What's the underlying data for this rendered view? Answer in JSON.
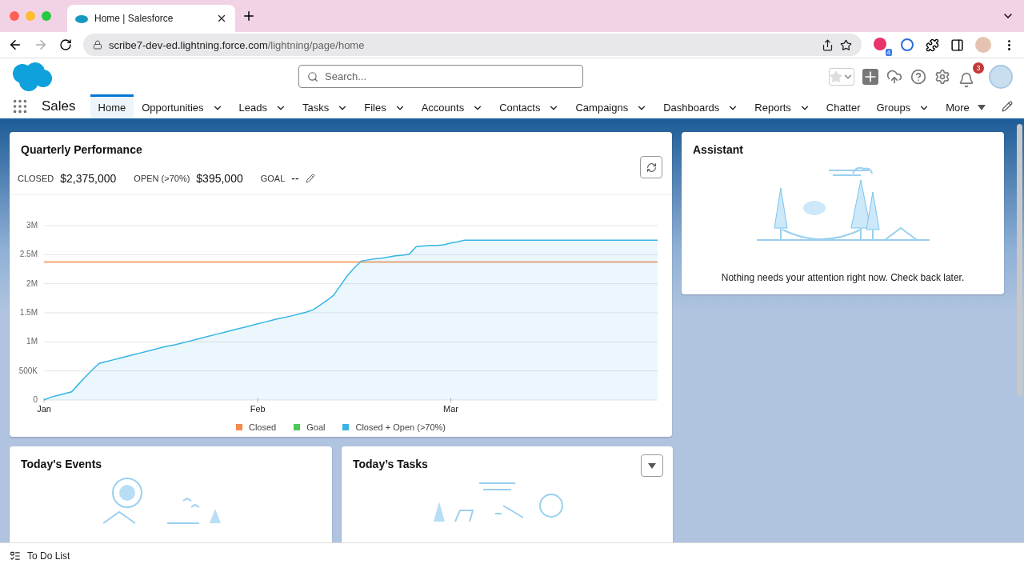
{
  "browser": {
    "tab_title": "Home | Salesforce",
    "url": {
      "host": "scribe7-dev-ed.lightning.force.com",
      "path": "/lightning/page/home"
    },
    "extension_badge": "4"
  },
  "header": {
    "search": {
      "placeholder": "Search..."
    },
    "notification_count": "3"
  },
  "nav": {
    "app_name": "Sales",
    "items": [
      {
        "label": "Home",
        "selected": true,
        "kind": "plain"
      },
      {
        "label": "Opportunities",
        "selected": false,
        "kind": "dropdown"
      },
      {
        "label": "Leads",
        "selected": false,
        "kind": "dropdown"
      },
      {
        "label": "Tasks",
        "selected": false,
        "kind": "dropdown"
      },
      {
        "label": "Files",
        "selected": false,
        "kind": "dropdown"
      },
      {
        "label": "Accounts",
        "selected": false,
        "kind": "dropdown"
      },
      {
        "label": "Contacts",
        "selected": false,
        "kind": "dropdown"
      },
      {
        "label": "Campaigns",
        "selected": false,
        "kind": "dropdown"
      },
      {
        "label": "Dashboards",
        "selected": false,
        "kind": "dropdown"
      },
      {
        "label": "Reports",
        "selected": false,
        "kind": "dropdown"
      },
      {
        "label": "Chatter",
        "selected": false,
        "kind": "plain"
      },
      {
        "label": "Groups",
        "selected": false,
        "kind": "dropdown"
      },
      {
        "label": "More",
        "selected": false,
        "kind": "more"
      }
    ]
  },
  "quarterly_performance": {
    "title": "Quarterly Performance",
    "metrics": [
      {
        "label": "CLOSED",
        "value": "$2,375,000"
      },
      {
        "label": "OPEN (>70%)",
        "value": "$395,000"
      },
      {
        "label": "GOAL",
        "value": "--"
      }
    ],
    "chart_data": {
      "type": "line",
      "categories": [
        "Jan",
        null,
        null,
        null,
        null,
        null,
        null,
        null,
        null,
        null,
        null,
        null,
        null,
        null,
        null,
        null,
        null,
        null,
        null,
        null,
        null,
        null,
        null,
        null,
        null,
        null,
        null,
        null,
        null,
        null,
        null,
        "Feb",
        null,
        null,
        null,
        null,
        null,
        null,
        null,
        null,
        null,
        null,
        null,
        null,
        null,
        null,
        null,
        null,
        null,
        null,
        null,
        null,
        null,
        null,
        null,
        null,
        null,
        null,
        null,
        "Mar",
        null,
        null,
        null,
        null,
        null,
        null,
        null,
        null,
        null,
        null,
        null,
        null,
        null,
        null,
        null,
        null,
        null,
        null,
        null,
        null,
        null,
        null,
        null,
        null,
        null,
        null,
        null,
        null,
        null,
        null
      ],
      "series": [
        {
          "name": "Closed",
          "color": "#f38b4a",
          "values": [
            2375000,
            2375000,
            2375000,
            2375000,
            2375000,
            2375000,
            2375000,
            2375000,
            2375000,
            2375000,
            2375000,
            2375000,
            2375000,
            2375000,
            2375000,
            2375000,
            2375000,
            2375000,
            2375000,
            2375000,
            2375000,
            2375000,
            2375000,
            2375000,
            2375000,
            2375000,
            2375000,
            2375000,
            2375000,
            2375000,
            2375000,
            2375000,
            2375000,
            2375000,
            2375000,
            2375000,
            2375000,
            2375000,
            2375000,
            2375000,
            2375000,
            2375000,
            2375000,
            2375000,
            2375000,
            2375000,
            2375000,
            2375000,
            2375000,
            2375000,
            2375000,
            2375000,
            2375000,
            2375000,
            2375000,
            2375000,
            2375000,
            2375000,
            2375000,
            2375000,
            2375000,
            2375000,
            2375000,
            2375000,
            2375000,
            2375000,
            2375000,
            2375000,
            2375000,
            2375000,
            2375000,
            2375000,
            2375000,
            2375000,
            2375000,
            2375000,
            2375000,
            2375000,
            2375000,
            2375000,
            2375000,
            2375000,
            2375000,
            2375000,
            2375000,
            2375000,
            2375000,
            2375000,
            2375000,
            2375000
          ]
        },
        {
          "name": "Goal",
          "color": "#4bca56",
          "values": [
            null,
            null,
            null,
            null,
            null,
            null,
            null,
            null,
            null,
            null,
            null,
            null,
            null,
            null,
            null,
            null,
            null,
            null,
            null,
            null,
            null,
            null,
            null,
            null,
            null,
            null,
            null,
            null,
            null,
            null,
            null,
            null,
            null,
            null,
            null,
            null,
            null,
            null,
            null,
            null,
            null,
            null,
            null,
            null,
            null,
            null,
            null,
            null,
            null,
            null,
            null,
            null,
            null,
            null,
            null,
            null,
            null,
            null,
            null,
            null,
            null,
            null,
            null,
            null,
            null,
            null,
            null,
            null,
            null,
            null,
            null,
            null,
            null,
            null,
            null,
            null,
            null,
            null,
            null,
            null,
            null,
            null,
            null,
            null,
            null,
            null,
            null,
            null,
            null,
            null
          ]
        },
        {
          "name": "Closed + Open (>70%)",
          "color": "#36b5e3",
          "values": [
            0,
            50000,
            80000,
            110000,
            140000,
            270000,
            400000,
            520000,
            630000,
            660000,
            690000,
            720000,
            750000,
            780000,
            810000,
            840000,
            870000,
            900000,
            930000,
            950000,
            980000,
            1010000,
            1040000,
            1070000,
            1100000,
            1130000,
            1160000,
            1190000,
            1220000,
            1250000,
            1280000,
            1310000,
            1340000,
            1370000,
            1400000,
            1420000,
            1450000,
            1480000,
            1510000,
            1550000,
            1630000,
            1710000,
            1800000,
            1970000,
            2140000,
            2270000,
            2390000,
            2410000,
            2430000,
            2440000,
            2460000,
            2480000,
            2490000,
            2510000,
            2640000,
            2650000,
            2660000,
            2660000,
            2670000,
            2700000,
            2720000,
            2750000,
            2750000,
            2750000,
            2750000,
            2750000,
            2750000,
            2750000,
            2750000,
            2750000,
            2750000,
            2750000,
            2750000,
            2750000,
            2750000,
            2750000,
            2750000,
            2750000,
            2750000,
            2750000,
            2750000,
            2750000,
            2750000,
            2750000,
            2750000,
            2750000,
            2750000,
            2750000,
            2750000,
            2750000
          ]
        }
      ],
      "ylim": [
        0,
        3000000
      ],
      "grid": true,
      "yticks": [
        {
          "value": 0,
          "label": "0"
        },
        {
          "value": 500000,
          "label": "500K"
        },
        {
          "value": 1000000,
          "label": "1M"
        },
        {
          "value": 1500000,
          "label": "1.5M"
        },
        {
          "value": 2000000,
          "label": "2M"
        },
        {
          "value": 2500000,
          "label": "2.5M"
        },
        {
          "value": 3000000,
          "label": "3M"
        }
      ]
    }
  },
  "assistant": {
    "title": "Assistant",
    "message": "Nothing needs your attention right now. Check back later."
  },
  "todays_events": {
    "title": "Today's Events"
  },
  "todays_tasks": {
    "title": "Today’s Tasks"
  },
  "footer": {
    "label": "To Do List"
  }
}
